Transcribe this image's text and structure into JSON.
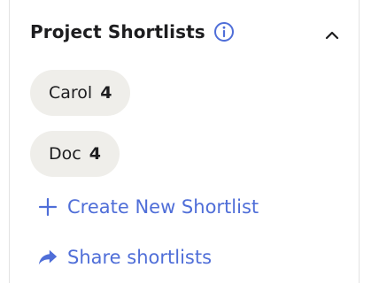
{
  "section": {
    "title": "Project Shortlists",
    "info_icon": "info-circle-icon",
    "collapse_icon": "chevron-up-icon"
  },
  "shortlists": [
    {
      "name": "Carol",
      "count": "4"
    },
    {
      "name": "Doc",
      "count": "4"
    }
  ],
  "actions": {
    "create_label": "Create New Shortlist",
    "share_label": "Share shortlists"
  },
  "colors": {
    "accent": "#4f6ed8",
    "chip_bg": "#efeeea",
    "text": "#1d1d1f"
  }
}
